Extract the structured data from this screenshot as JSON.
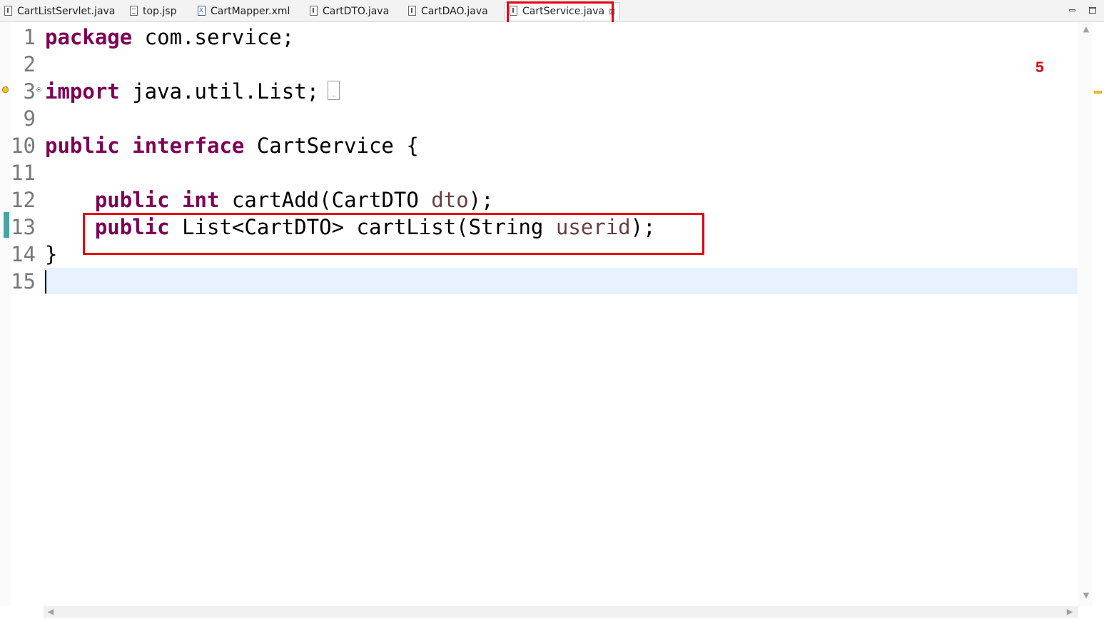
{
  "tabs": [
    {
      "label": "CartListServlet.java",
      "type": "java",
      "active": false
    },
    {
      "label": "top.jsp",
      "type": "jsp",
      "active": false
    },
    {
      "label": "CartMapper.xml",
      "type": "xml",
      "active": false
    },
    {
      "label": "CartDTO.java",
      "type": "java",
      "active": false
    },
    {
      "label": "CartDAO.java",
      "type": "java",
      "active": false
    },
    {
      "label": "CartService.java",
      "type": "java",
      "active": true
    }
  ],
  "close_icon_glyph": "⊠",
  "annotation": {
    "number": "5",
    "highlight_color": "#e3000f"
  },
  "editor": {
    "line_numbers": [
      "1",
      "2",
      "3",
      "9",
      "10",
      "11",
      "12",
      "13",
      "14",
      "15"
    ],
    "current_line": "15",
    "lines": [
      [
        {
          "t": "package",
          "k": "kw"
        },
        {
          "t": " com.service;"
        }
      ],
      [],
      [
        {
          "t": "import",
          "k": "kw"
        },
        {
          "t": " java.util.List;"
        }
      ],
      [],
      [
        {
          "t": "public",
          "k": "kw"
        },
        {
          "t": " "
        },
        {
          "t": "interface",
          "k": "kw"
        },
        {
          "t": " CartService {"
        }
      ],
      [],
      [
        {
          "t": "    "
        },
        {
          "t": "public",
          "k": "kw"
        },
        {
          "t": " "
        },
        {
          "t": "int",
          "k": "kw"
        },
        {
          "t": " cartAdd(CartDTO "
        },
        {
          "t": "dto",
          "k": "param"
        },
        {
          "t": ");"
        }
      ],
      [
        {
          "t": "    "
        },
        {
          "t": "public",
          "k": "kw"
        },
        {
          "t": " List<CartDTO> cartList(String "
        },
        {
          "t": "userid",
          "k": "param"
        },
        {
          "t": ");"
        }
      ],
      [
        {
          "t": "}"
        }
      ],
      []
    ]
  },
  "colors": {
    "keyword": "#7f0055",
    "parameter": "#6a3e3e",
    "current_line_bg": "#e8f2fe"
  }
}
